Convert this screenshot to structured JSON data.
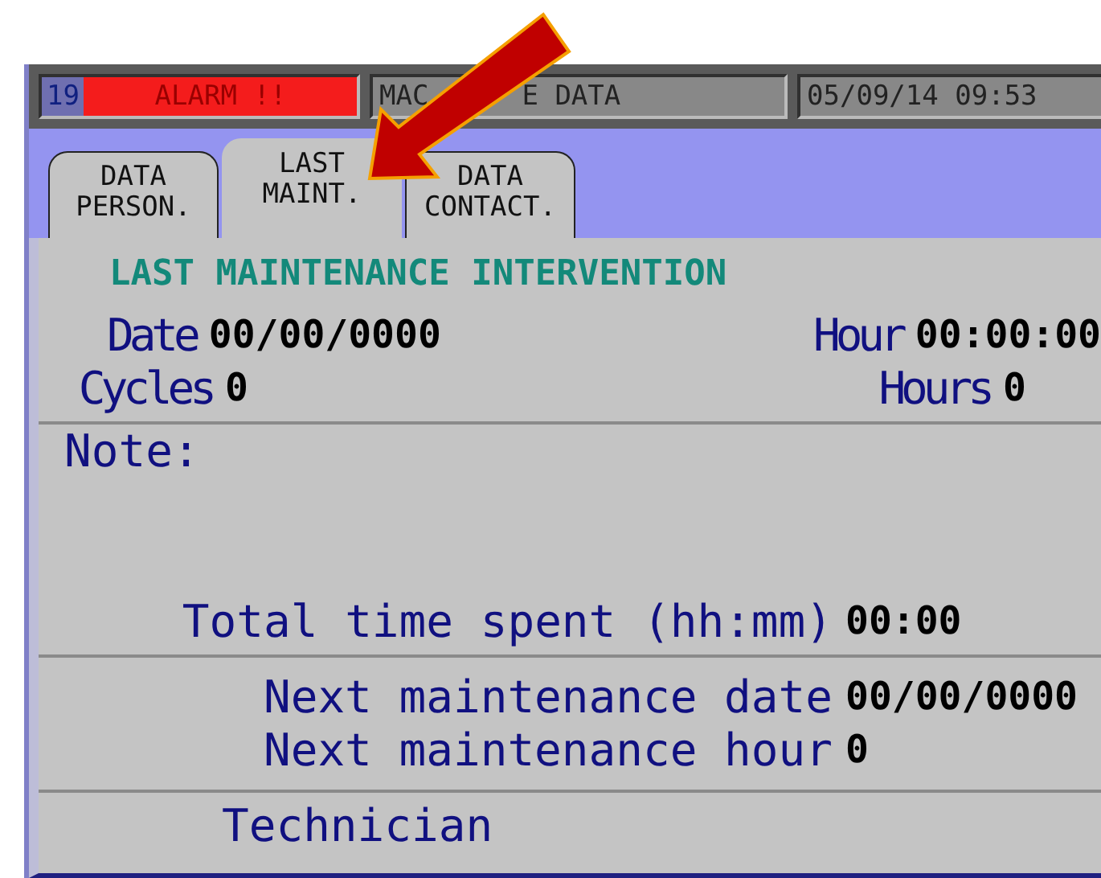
{
  "header": {
    "alarm_count": "19",
    "alarm_text": "ALARM !!",
    "title_parts": [
      "MAC",
      "E DATA"
    ],
    "datetime": "05/09/14  09:53"
  },
  "tabs": [
    {
      "label": "DATA\nPERSON.",
      "selected": false
    },
    {
      "label": "LAST\nMAINT.",
      "selected": true
    },
    {
      "label": "DATA\nCONTACT.",
      "selected": false
    }
  ],
  "section_title": "LAST MAINTENANCE INTERVENTION",
  "summary_rows": [
    [
      {
        "label": "Date",
        "value": "00/00/0000"
      },
      {
        "label": "Hour",
        "value": "00:00:00"
      }
    ],
    [
      {
        "label": "Cycles",
        "value": "0"
      },
      {
        "label": "Hours",
        "value": "0"
      }
    ]
  ],
  "note_label": "Note:",
  "total_time": {
    "label": "Total time spent (hh:mm)",
    "value": "00:00"
  },
  "next_rows": [
    {
      "label": "Next maintenance date",
      "value": "00/00/0000"
    },
    {
      "label": "Next maintenance hour",
      "value": "0"
    }
  ],
  "technician_label": "Technician"
}
